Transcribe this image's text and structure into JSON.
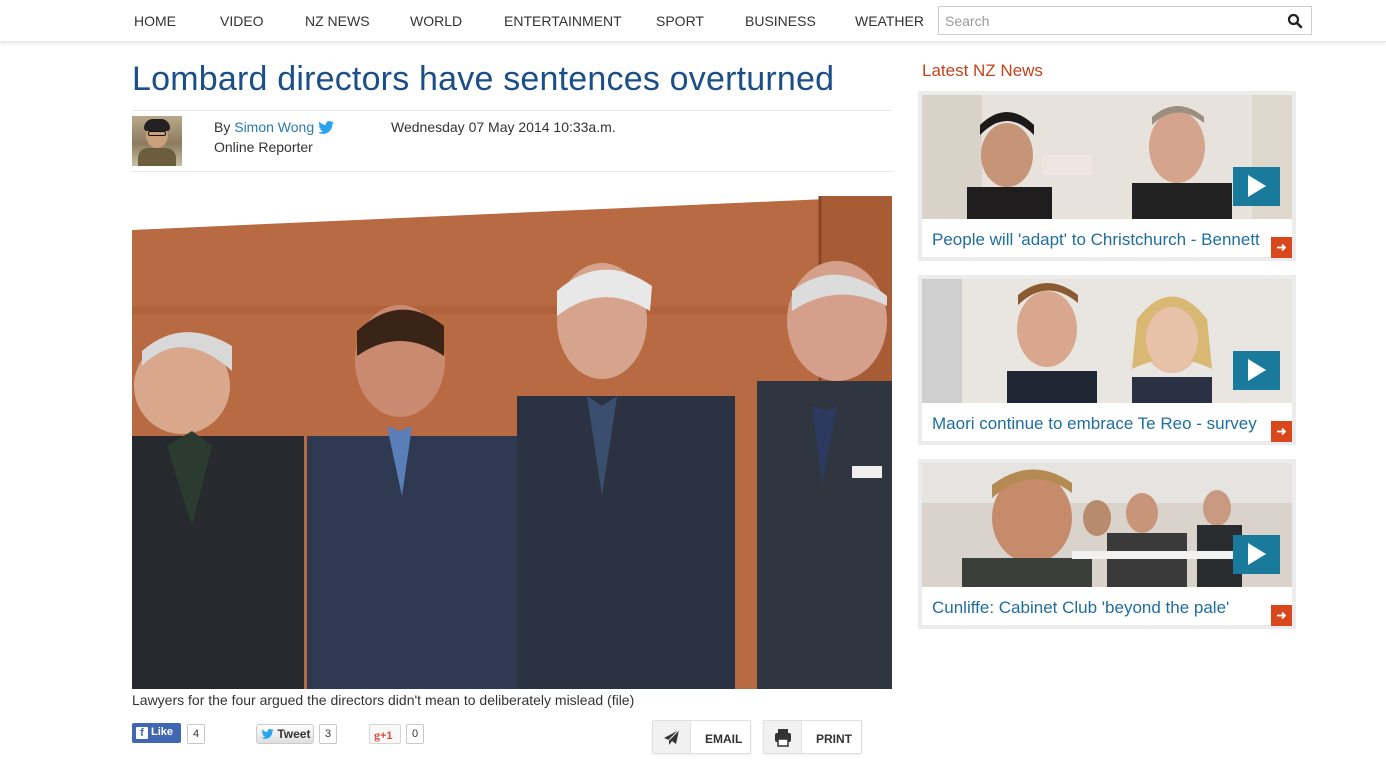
{
  "nav": {
    "items": [
      "HOME",
      "VIDEO",
      "NZ NEWS",
      "WORLD",
      "ENTERTAINMENT",
      "SPORT",
      "BUSINESS",
      "WEATHER"
    ],
    "search_placeholder": "Search",
    "search_icon": "search-icon"
  },
  "article": {
    "headline": "Lombard directors have sentences overturned",
    "by_prefix": "By",
    "author": "Simon Wong",
    "role": "Online Reporter",
    "date": "Wednesday 07 May 2014 10:33a.m.",
    "caption": "Lawyers for the four argued the directors didn't mean to deliberately mislead (file)"
  },
  "social": {
    "like_label": "Like",
    "like_count": "4",
    "tweet_label": "Tweet",
    "tweet_count": "3",
    "gplus_label": "+1",
    "gplus_count": "0",
    "email_label": "EMAIL",
    "print_label": "PRINT"
  },
  "sidebar": {
    "title": "Latest NZ News",
    "cards": [
      {
        "title": "People will 'adapt' to Christchurch - Bennett"
      },
      {
        "title": "Maori continue to embrace Te Reo - survey"
      },
      {
        "title": "Cunliffe: Cabinet Club 'beyond the pale'"
      }
    ]
  },
  "colors": {
    "headline": "#1b4f87",
    "link": "#2a7ab0",
    "sidebar_title": "#c1441c",
    "play_button": "#1a7a9c",
    "arrow_button": "#d8481c",
    "facebook": "#4267b2"
  }
}
